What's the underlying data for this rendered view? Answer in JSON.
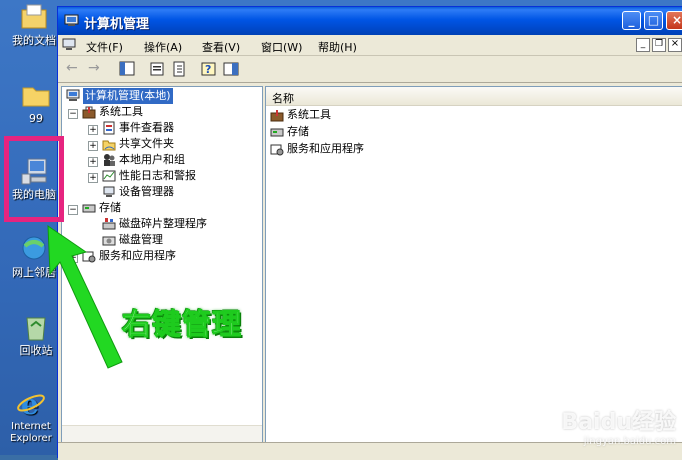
{
  "desktop": {
    "icons": [
      {
        "label": "我的文档",
        "icon": "my-documents-icon"
      },
      {
        "label": "99",
        "icon": "folder-icon"
      },
      {
        "label": "我的电脑",
        "icon": "my-computer-icon"
      },
      {
        "label": "网上邻居",
        "icon": "network-places-icon"
      },
      {
        "label": "回收站",
        "icon": "recycle-bin-icon"
      },
      {
        "label": "Internet Explorer",
        "icon": "ie-icon"
      }
    ]
  },
  "window": {
    "title": "计算机管理",
    "menu": [
      "文件(F)",
      "操作(A)",
      "查看(V)",
      "窗口(W)",
      "帮助(H)"
    ],
    "tree": {
      "root": "计算机管理(本地)",
      "items": [
        {
          "label": "系统工具",
          "expander": "−"
        },
        {
          "label": "事件查看器",
          "expander": "+"
        },
        {
          "label": "共享文件夹",
          "expander": "+"
        },
        {
          "label": "本地用户和组",
          "expander": "+"
        },
        {
          "label": "性能日志和警报",
          "expander": "+"
        },
        {
          "label": "设备管理器",
          "expander": ""
        },
        {
          "label": "存储",
          "expander": "−"
        },
        {
          "label": "磁盘碎片整理程序",
          "expander": ""
        },
        {
          "label": "磁盘管理",
          "expander": ""
        },
        {
          "label": "服务和应用程序",
          "expander": "+"
        }
      ]
    },
    "list": {
      "column_name": "名称",
      "items": [
        "系统工具",
        "存储",
        "服务和应用程序"
      ]
    }
  },
  "annotation": {
    "text": "右键管理",
    "highlight_color": "#e6247f",
    "arrow_color": "#22d822"
  },
  "watermark": {
    "text": "Baidu经验",
    "sub": "jingyan.baidu.com"
  }
}
